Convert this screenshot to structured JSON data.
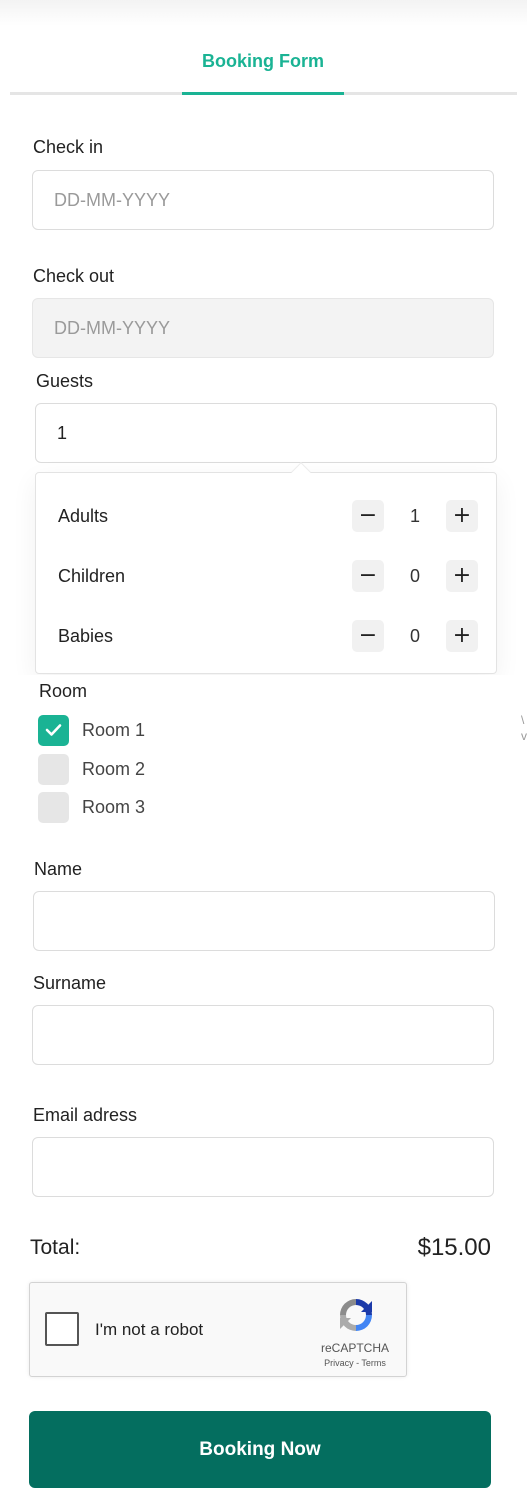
{
  "tabs": {
    "active_label": "Booking Form"
  },
  "check_in": {
    "label": "Check in",
    "placeholder": "DD-MM-YYYY"
  },
  "check_out": {
    "label": "Check out",
    "placeholder": "DD-MM-YYYY"
  },
  "guests": {
    "label": "Guests",
    "value": "1",
    "rows": [
      {
        "label": "Adults",
        "count": "1",
        "minus_icon": "minus-icon",
        "plus_icon": "plus-icon"
      },
      {
        "label": "Children",
        "count": "0",
        "minus_icon": "minus-icon",
        "plus_icon": "plus-icon"
      },
      {
        "label": "Babies",
        "count": "0",
        "minus_icon": "minus-icon",
        "plus_icon": "plus-icon"
      }
    ]
  },
  "room": {
    "label": "Room",
    "options": [
      {
        "label": "Room 1",
        "checked": true
      },
      {
        "label": "Room 2",
        "checked": false
      },
      {
        "label": "Room 3",
        "checked": false
      }
    ]
  },
  "side_fragment": [
    "\\",
    "v"
  ],
  "name": {
    "label": "Name",
    "value": ""
  },
  "surname": {
    "label": "Surname",
    "value": ""
  },
  "email": {
    "label": "Email adress",
    "value": ""
  },
  "total": {
    "label": "Total:",
    "amount": "$15.00"
  },
  "captcha": {
    "label": "I'm not a robot",
    "brand": "reCAPTCHA",
    "links": "Privacy - Terms",
    "checked": false
  },
  "submit_label": "Booking Now",
  "colors": {
    "accent": "#1ab394",
    "primary_button": "#046e5f",
    "disabled_field": "#f3f3f3"
  }
}
